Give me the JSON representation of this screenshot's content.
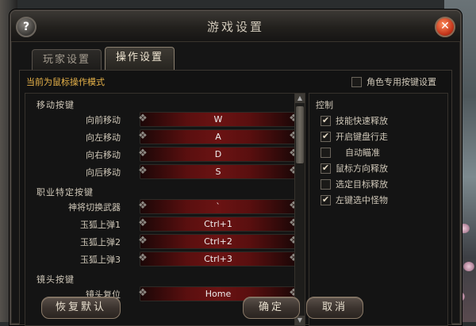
{
  "window": {
    "title": "游戏设置"
  },
  "tabs": [
    {
      "label": "玩家设置",
      "active": false
    },
    {
      "label": "操作设置",
      "active": true
    }
  ],
  "mode_label": "当前为鼠标操作模式",
  "role_keys": {
    "label": "角色专用按键设置",
    "checked": false
  },
  "sections": {
    "move": "移动按键",
    "job": "职业特定按键",
    "camera": "镜头按键"
  },
  "keys": [
    {
      "label": "向前移动",
      "binding": "W"
    },
    {
      "label": "向左移动",
      "binding": "A"
    },
    {
      "label": "向右移动",
      "binding": "D"
    },
    {
      "label": "向后移动",
      "binding": "S"
    },
    {
      "label": "神将切换武器",
      "binding": "`"
    },
    {
      "label": "玉狐上弹1",
      "binding": "Ctrl+1"
    },
    {
      "label": "玉狐上弹2",
      "binding": "Ctrl+2"
    },
    {
      "label": "玉狐上弹3",
      "binding": "Ctrl+3"
    },
    {
      "label": "镜头复位",
      "binding": "Home"
    }
  ],
  "control": {
    "title": "控制",
    "items": [
      {
        "label": "技能快速释放",
        "checked": true
      },
      {
        "label": "开启键盘行走",
        "checked": true
      },
      {
        "label": "自动瞄准",
        "checked": false
      },
      {
        "label": "鼠标方向释放",
        "checked": true
      },
      {
        "label": "选定目标释放",
        "checked": false
      },
      {
        "label": "左键选中怪物",
        "checked": true
      }
    ]
  },
  "buttons": {
    "reset": "恢复默认",
    "ok": "确定",
    "cancel": "取消"
  },
  "colors": {
    "accent": "#e9b44a",
    "binding_bg": "#6b1313"
  }
}
